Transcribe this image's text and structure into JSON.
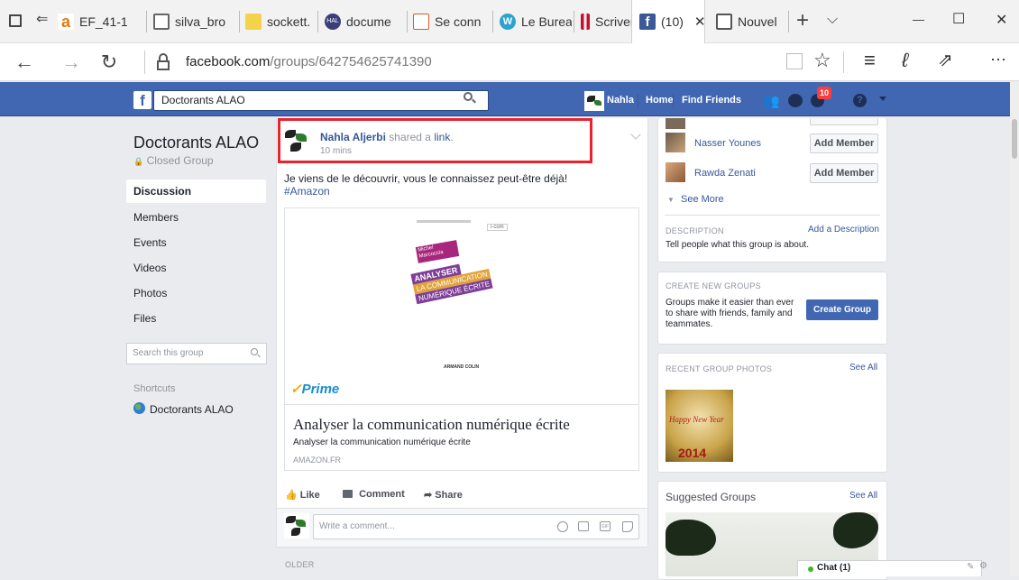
{
  "browser": {
    "tabs": [
      {
        "label": "EF_41-1",
        "icon": "amazon-icon",
        "color": "#e47911"
      },
      {
        "label": "silva_bro",
        "icon": "page-icon",
        "color": "#666666"
      },
      {
        "label": "sockett.",
        "icon": "elf-icon",
        "color": "#c9a100"
      },
      {
        "label": "docume",
        "icon": "hal-icon",
        "color": "#3a3f7a"
      },
      {
        "label": "Se conn",
        "icon": "cairn-icon",
        "color": "#d85a2b"
      },
      {
        "label": "Le Burea",
        "icon": "wordpress-icon",
        "color": "#2aa4cf"
      },
      {
        "label": "Scrivene",
        "icon": "scrivener-icon",
        "color": "#c8102e"
      },
      {
        "label": "(10)",
        "icon": "facebook-icon",
        "color": "#3b5998"
      },
      {
        "label": "Nouvel",
        "icon": "newtab-icon",
        "color": "#555555"
      }
    ],
    "close_tab": "✕",
    "new_tab": "+",
    "tab_menu": "⌵",
    "win_min": "—",
    "win_max": "☐",
    "win_close": "✕",
    "url_host": "facebook.com",
    "url_path": "/groups/642754625741390"
  },
  "fb": {
    "logo": "f",
    "search_value": "Doctorants ALAO",
    "user_name": "Nahla",
    "home": "Home",
    "find_friends": "Find Friends",
    "notif_count": "10"
  },
  "group": {
    "name": "Doctorants ALAO",
    "privacy": "Closed Group",
    "nav": [
      "Discussion",
      "Members",
      "Events",
      "Videos",
      "Photos",
      "Files"
    ],
    "search_placeholder": "Search this group",
    "shortcuts_label": "Shortcuts",
    "shortcut_item": "Doctorants ALAO"
  },
  "post": {
    "author": "Nahla Aljerbi",
    "shared": "shared a",
    "link_word": "link",
    "period": ".",
    "time": "10 mins",
    "text": "Je viens de le découvrir, vous le connaissez peut-être déjà!",
    "hashtag": "#Amazon",
    "book_author": "Michel Marcoccia",
    "book_title_1": "ANALYSER",
    "book_title_2": "LA COMMUNICATION",
    "book_title_3": "NUMÉRIQUE ÉCRITE",
    "book_publisher": "ARMAND COLIN",
    "book_badge": "i-com",
    "prime": "Prime",
    "link_title": "Analyser la communication numérique écrite",
    "link_desc": "Analyser la communication numérique écrite",
    "link_domain": "AMAZON.FR",
    "like": "Like",
    "comment": "Comment",
    "share": "Share",
    "comment_placeholder": "Write a comment...",
    "older": "OLDER"
  },
  "right": {
    "members": [
      {
        "name": "Nasser Younes",
        "button": "Add Member"
      },
      {
        "name": "Rawda Zenati",
        "button": "Add Member"
      }
    ],
    "see_more": "See More",
    "desc_header": "DESCRIPTION",
    "add_desc": "Add a Description",
    "desc_text": "Tell people what this group is about.",
    "create_header": "CREATE NEW GROUPS",
    "create_text": "Groups make it easier than ever to share with friends, family and teammates.",
    "create_button": "Create Group",
    "photos_header": "RECENT GROUP PHOTOS",
    "see_all": "See All",
    "photo_caption": "Happy New Year",
    "photo_year": "2014",
    "suggested_header": "Suggested Groups",
    "see_all_2": "See All",
    "chat": "Chat (1)"
  },
  "colors": {
    "fb_blue": "#4267b2",
    "link": "#365899",
    "highlight": "#e8232f",
    "prime": "#f6a800"
  }
}
